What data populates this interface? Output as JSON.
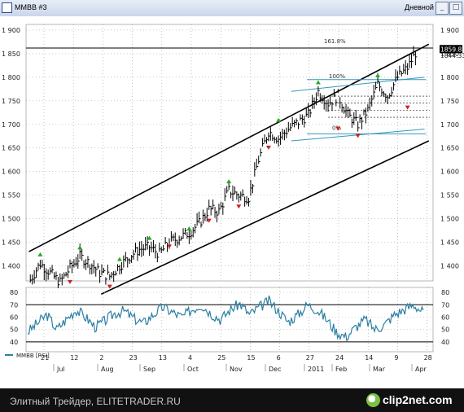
{
  "window": {
    "title": "MMBB #3",
    "timeframe": "Дневной",
    "minimize_glyph": "_",
    "maximize_glyph": "□",
    "close_glyph": "×"
  },
  "price_panel": {
    "y_ticks": [
      "1 900",
      "1 850",
      "1 800",
      "1 750",
      "1 700",
      "1 650",
      "1 600",
      "1 550",
      "1 500",
      "1 450",
      "1 400"
    ],
    "y_tick_values": [
      1900,
      1850,
      1800,
      1750,
      1700,
      1650,
      1600,
      1550,
      1500,
      1450,
      1400
    ],
    "last_price": "1859.88",
    "secondary_price": "1844.33",
    "fib_labels": [
      "161.8%",
      "100%",
      "0%"
    ],
    "levels": {
      "fib_161": 1862,
      "resistance": 1795,
      "support": 1680
    }
  },
  "rsi_panel": {
    "legend": "MMBB [RSI]",
    "y_ticks": [
      "80",
      "70",
      "60",
      "50",
      "40"
    ],
    "y_tick_values": [
      80,
      70,
      60,
      50,
      40
    ],
    "levels": [
      70,
      40
    ]
  },
  "x_axis": {
    "days": [
      "21",
      "12",
      "2",
      "23",
      "13",
      "4",
      "25",
      "15",
      "6",
      "27",
      "24",
      "14",
      "9",
      "28"
    ],
    "months": [
      "Jul",
      "Aug",
      "Sep",
      "Oct",
      "Nov",
      "Dec",
      "2011",
      "Feb",
      "Mar",
      "Apr"
    ]
  },
  "footer": {
    "text": "Элитный Трейдер, ELITETRADER.RU",
    "logo": "clip2net.com"
  },
  "colors": {
    "price_bars": "#000000",
    "rsi_line": "#2b7fa3",
    "trend_channel": "#000000",
    "fib_lines": "#3399bb",
    "signal_up": "#22aa22",
    "signal_down": "#cc2222"
  },
  "chart_data": {
    "type": "ohlc",
    "x_kind": "date",
    "close_series": [
      [
        "2010-07-01",
        1370
      ],
      [
        "2010-07-08",
        1405
      ],
      [
        "2010-07-15",
        1385
      ],
      [
        "2010-07-22",
        1365
      ],
      [
        "2010-07-29",
        1395
      ],
      [
        "2010-08-05",
        1420
      ],
      [
        "2010-08-12",
        1405
      ],
      [
        "2010-08-19",
        1385
      ],
      [
        "2010-08-26",
        1378
      ],
      [
        "2010-09-02",
        1400
      ],
      [
        "2010-09-09",
        1420
      ],
      [
        "2010-09-16",
        1435
      ],
      [
        "2010-09-23",
        1440
      ],
      [
        "2010-09-30",
        1425
      ],
      [
        "2010-10-07",
        1450
      ],
      [
        "2010-10-14",
        1460
      ],
      [
        "2010-10-21",
        1470
      ],
      [
        "2010-10-28",
        1490
      ],
      [
        "2010-11-04",
        1520
      ],
      [
        "2010-11-11",
        1515
      ],
      [
        "2010-11-18",
        1560
      ],
      [
        "2010-11-25",
        1550
      ],
      [
        "2010-12-02",
        1545
      ],
      [
        "2010-12-09",
        1625
      ],
      [
        "2010-12-16",
        1685
      ],
      [
        "2010-12-23",
        1670
      ],
      [
        "2010-12-30",
        1690
      ],
      [
        "2011-01-13",
        1720
      ],
      [
        "2011-01-20",
        1770
      ],
      [
        "2011-01-27",
        1745
      ],
      [
        "2011-02-03",
        1760
      ],
      [
        "2011-02-10",
        1720
      ],
      [
        "2011-02-17",
        1700
      ],
      [
        "2011-02-24",
        1730
      ],
      [
        "2011-03-03",
        1785
      ],
      [
        "2011-03-10",
        1760
      ],
      [
        "2011-03-17",
        1800
      ],
      [
        "2011-03-24",
        1820
      ],
      [
        "2011-03-31",
        1860
      ]
    ],
    "rsi_series": [
      48,
      55,
      62,
      50,
      58,
      66,
      60,
      52,
      57,
      63,
      65,
      59,
      55,
      62,
      68,
      64,
      60,
      66,
      70,
      63,
      58,
      66,
      71,
      62,
      68,
      73,
      65,
      56,
      62,
      70,
      66,
      58,
      48,
      44,
      52,
      58,
      50,
      54,
      62,
      66,
      70,
      64
    ],
    "signals_up": [
      [
        "2010-07-08",
        1420
      ],
      [
        "2010-08-05",
        1435
      ],
      [
        "2010-09-02",
        1410
      ],
      [
        "2010-09-23",
        1455
      ],
      [
        "2010-10-21",
        1475
      ],
      [
        "2010-11-18",
        1575
      ],
      [
        "2010-12-23",
        1705
      ],
      [
        "2011-01-20",
        1785
      ],
      [
        "2011-03-03",
        1800
      ]
    ],
    "signals_down": [
      [
        "2010-07-29",
        1370
      ],
      [
        "2010-08-26",
        1360
      ],
      [
        "2010-10-07",
        1445
      ],
      [
        "2010-11-04",
        1500
      ],
      [
        "2010-11-25",
        1530
      ],
      [
        "2010-12-16",
        1655
      ],
      [
        "2011-02-03",
        1695
      ],
      [
        "2011-02-17",
        1680
      ],
      [
        "2011-03-24",
        1740
      ]
    ],
    "trend_channel": {
      "upper": [
        [
          "2010-06-30",
          1430
        ],
        [
          "2011-04-08",
          1870
        ]
      ],
      "lower": [
        [
          "2010-08-20",
          1340
        ],
        [
          "2011-04-08",
          1665
        ]
      ]
    }
  }
}
